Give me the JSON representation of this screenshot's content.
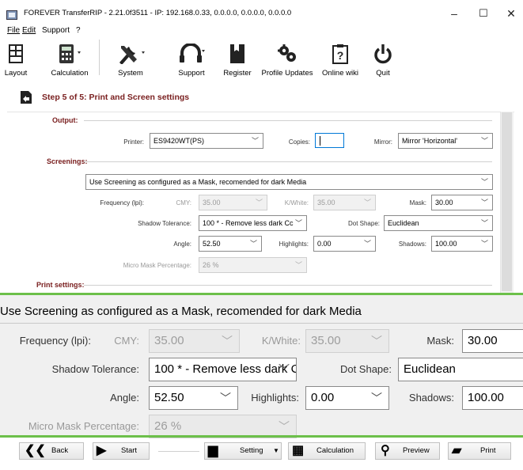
{
  "window": {
    "title": "FOREVER TransferRIP - 2.21.0f3511 - IP: 192.168.0.33, 0.0.0.0, 0.0.0.0, 0.0.0.0",
    "minimize": "–",
    "maximize": "☐",
    "close": "✕"
  },
  "menu": {
    "file": "File",
    "edit": "Edit",
    "support": "Support",
    "help": "?"
  },
  "toolbar": {
    "layout": "Layout",
    "calculation": "Calculation",
    "system": "System",
    "support": "Support",
    "register": "Register",
    "profile_updates": "Profile Updates",
    "online_wiki": "Online wiki",
    "quit": "Quit"
  },
  "step": {
    "title": "Step 5 of 5: Print and Screen settings"
  },
  "output": {
    "section": "Output:",
    "printer_label": "Printer:",
    "printer_value": "ES9420WT(PS)",
    "copies_label": "Copies:",
    "copies_value": "1",
    "mirror_label": "Mirror:",
    "mirror_value": "Mirror 'Horizontal'"
  },
  "screenings": {
    "section": "Screenings:",
    "mode_value": "Use Screening as configured as a Mask, recomended for dark Media",
    "frequency_label": "Frequency (lpi):",
    "cmy_label": "CMY:",
    "cmy_value": "35.00",
    "kwhite_label": "K/White:",
    "kwhite_value": "35.00",
    "mask_label": "Mask:",
    "mask_value": "30.00",
    "shadow_tol_label": "Shadow Tolerance:",
    "shadow_tol_value": "100 * - Remove less dark Cc",
    "dot_shape_label": "Dot Shape:",
    "dot_shape_value": "Euclidean",
    "angle_label": "Angle:",
    "angle_value": "52.50",
    "highlights_label": "Highlights:",
    "highlights_value": "0.00",
    "shadows_label": "Shadows:",
    "shadows_value": "100.00",
    "micro_mask_label": "Micro Mask Percentage:",
    "micro_mask_value": "26 %"
  },
  "print_settings": {
    "section": "Print settings:"
  },
  "bottom": {
    "back": "Back",
    "start": "Start",
    "setting": "Setting",
    "calculation": "Calculation",
    "preview": "Preview",
    "print": "Print"
  },
  "colors": {
    "accent_green": "#6cc04a",
    "section_red": "#7a2020",
    "focus_blue": "#0078d7"
  }
}
